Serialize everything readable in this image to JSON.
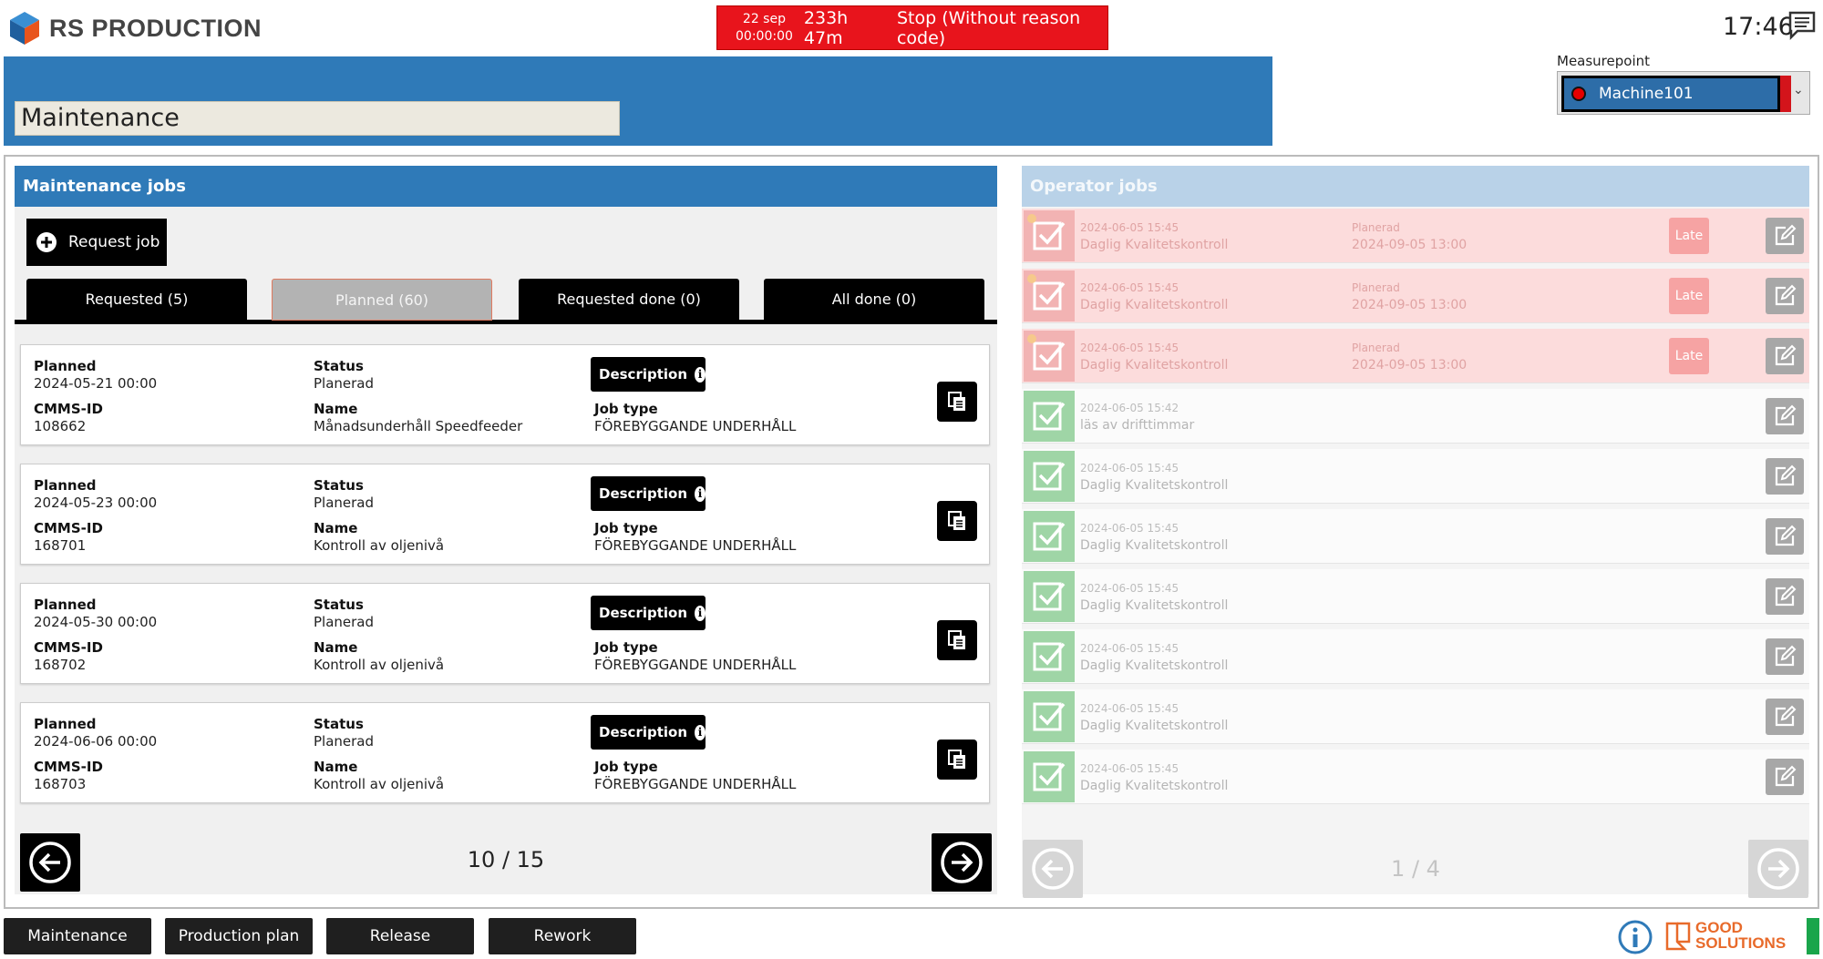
{
  "app": {
    "name": "RS PRODUCTION",
    "clock": "17:46"
  },
  "stop_banner": {
    "date": "22 sep",
    "time": "00:00:00",
    "duration": "233h 47m",
    "reason": "Stop (Without reason code)"
  },
  "page": {
    "title": "Maintenance"
  },
  "measurepoint": {
    "label": "Measurepoint",
    "value": "Machine101"
  },
  "maintenance": {
    "header": "Maintenance jobs",
    "request_label": "Request job",
    "tabs": [
      {
        "label": "Requested (5)"
      },
      {
        "label": "Planned (60)"
      },
      {
        "label": "Requested done (0)"
      },
      {
        "label": "All done (0)"
      }
    ],
    "field_labels": {
      "planned": "Planned",
      "status": "Status",
      "cmms": "CMMS-ID",
      "name": "Name",
      "job_type": "Job type",
      "description": "Description"
    },
    "jobs": [
      {
        "planned": "2024-05-21 00:00",
        "status": "Planerad",
        "cmms": "108662",
        "name": "Månadsunderhåll Speedfeeder",
        "job_type": "FÖREBYGGANDE UNDERHÅLL"
      },
      {
        "planned": "2024-05-23 00:00",
        "status": "Planerad",
        "cmms": "168701",
        "name": "Kontroll av oljenivå",
        "job_type": "FÖREBYGGANDE UNDERHÅLL"
      },
      {
        "planned": "2024-05-30 00:00",
        "status": "Planerad",
        "cmms": "168702",
        "name": "Kontroll av oljenivå",
        "job_type": "FÖREBYGGANDE UNDERHÅLL"
      },
      {
        "planned": "2024-06-06 00:00",
        "status": "Planerad",
        "cmms": "168703",
        "name": "Kontroll av oljenivå",
        "job_type": "FÖREBYGGANDE UNDERHÅLL"
      }
    ],
    "page_indicator": "10 / 15"
  },
  "operator": {
    "header": "Operator jobs",
    "planned_label": "Planerad",
    "late_label": "Late",
    "jobs": [
      {
        "date": "2024-06-05 15:45",
        "name": "Daglig Kvalitetskontroll",
        "planned": "2024-09-05 13:00",
        "late": true
      },
      {
        "date": "2024-06-05 15:45",
        "name": "Daglig Kvalitetskontroll",
        "planned": "2024-09-05 13:00",
        "late": true
      },
      {
        "date": "2024-06-05 15:45",
        "name": "Daglig Kvalitetskontroll",
        "planned": "2024-09-05 13:00",
        "late": true
      },
      {
        "date": "2024-06-05 15:42",
        "name": "läs av drifttimmar",
        "late": false
      },
      {
        "date": "2024-06-05 15:45",
        "name": "Daglig Kvalitetskontroll",
        "late": false
      },
      {
        "date": "2024-06-05 15:45",
        "name": "Daglig Kvalitetskontroll",
        "late": false
      },
      {
        "date": "2024-06-05 15:45",
        "name": "Daglig Kvalitetskontroll",
        "late": false
      },
      {
        "date": "2024-06-05 15:45",
        "name": "Daglig Kvalitetskontroll",
        "late": false
      },
      {
        "date": "2024-06-05 15:45",
        "name": "Daglig Kvalitetskontroll",
        "late": false
      },
      {
        "date": "2024-06-05 15:45",
        "name": "Daglig Kvalitetskontroll",
        "late": false
      }
    ],
    "page_indicator": "1 / 4"
  },
  "bottom_nav": [
    {
      "label": "Maintenance"
    },
    {
      "label": "Production plan"
    },
    {
      "label": "Release"
    },
    {
      "label": "Rework"
    }
  ],
  "brand": {
    "line1": "GOOD",
    "line2": "SOLUTIONS"
  },
  "colors": {
    "accent": "#2f7ab8",
    "stop": "#e8141c",
    "late": "#fcdcdc",
    "done": "#9fd5a6",
    "status_ok": "#1aa54b"
  }
}
